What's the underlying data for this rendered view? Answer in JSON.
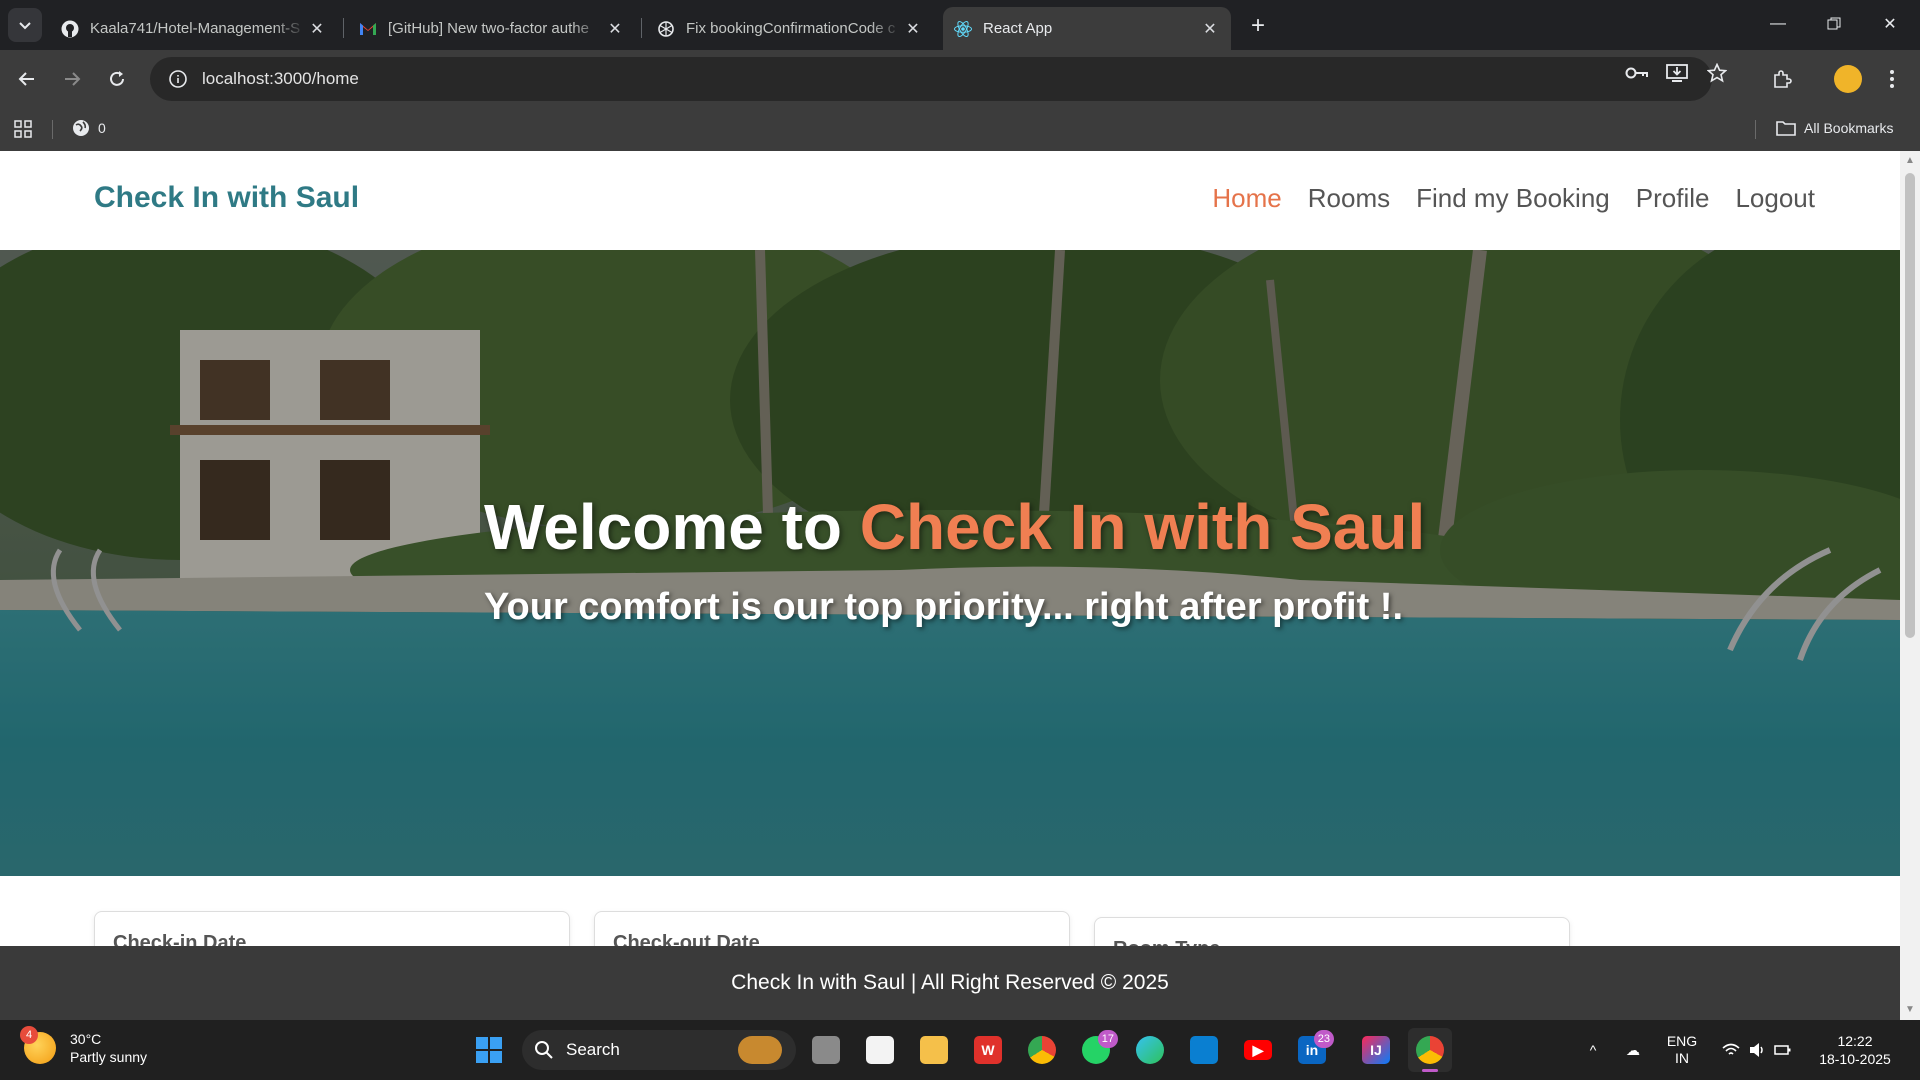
{
  "browser": {
    "tabs": [
      {
        "title": "Kaala741/Hotel-Management-S",
        "icon": "github-icon"
      },
      {
        "title": "[GitHub] New two-factor authe",
        "icon": "gmail-icon"
      },
      {
        "title": "Fix bookingConfirmationCode c",
        "icon": "chatgpt-icon"
      },
      {
        "title": "React App",
        "icon": "react-icon"
      }
    ],
    "url": "localhost:3000/home",
    "bookmarks": {
      "counter": "0",
      "all_bookmarks": "All Bookmarks"
    }
  },
  "site": {
    "brand": "Check In with Saul",
    "nav": [
      {
        "label": "Home",
        "active": true
      },
      {
        "label": "Rooms",
        "active": false
      },
      {
        "label": "Find my Booking",
        "active": false
      },
      {
        "label": "Profile",
        "active": false
      },
      {
        "label": "Logout",
        "active": false
      }
    ],
    "hero": {
      "welcome": "Welcome to",
      "brand_accent": "Check In with Saul",
      "subtitle": "Your comfort is our top priority... right after profit !."
    },
    "search": {
      "checkin_label": "Check-in Date",
      "checkout_label": "Check-out Date",
      "room_type_label": "Room Type"
    },
    "footer": "Check In with Saul | All Right Reserved © 2025"
  },
  "colors": {
    "brand": "#2f7a85",
    "accent": "#e5734a",
    "footer_bg": "#3a3a3a"
  },
  "taskbar": {
    "weather": {
      "temp": "30°C",
      "desc": "Partly sunny",
      "badge": "4"
    },
    "search_label": "Search",
    "badges": {
      "whatsapp": "17",
      "linkedin": "23"
    },
    "lang": {
      "line1": "ENG",
      "line2": "IN"
    },
    "time": "12:22",
    "date": "18-10-2025"
  }
}
